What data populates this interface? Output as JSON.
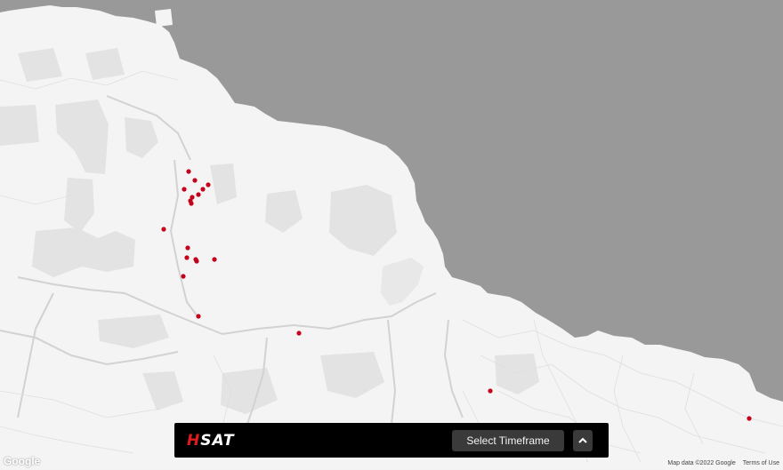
{
  "colors": {
    "ocean": "#999999",
    "land": "#f4f4f4",
    "land_dark": "#e2e2e2",
    "river": "#d6d6d6",
    "marker": "#c4001a",
    "bar": "#000000",
    "brand_red": "#e01b1b"
  },
  "brand": {
    "logo_h": "H",
    "logo_rest": "SAT"
  },
  "controls": {
    "timeframe_label": "Select Timeframe",
    "expand_icon": "chevron-up-icon"
  },
  "map": {
    "google_logo": "Google",
    "attribution": "Map data ©2022 Google",
    "terms": "Terms of Use"
  }
}
